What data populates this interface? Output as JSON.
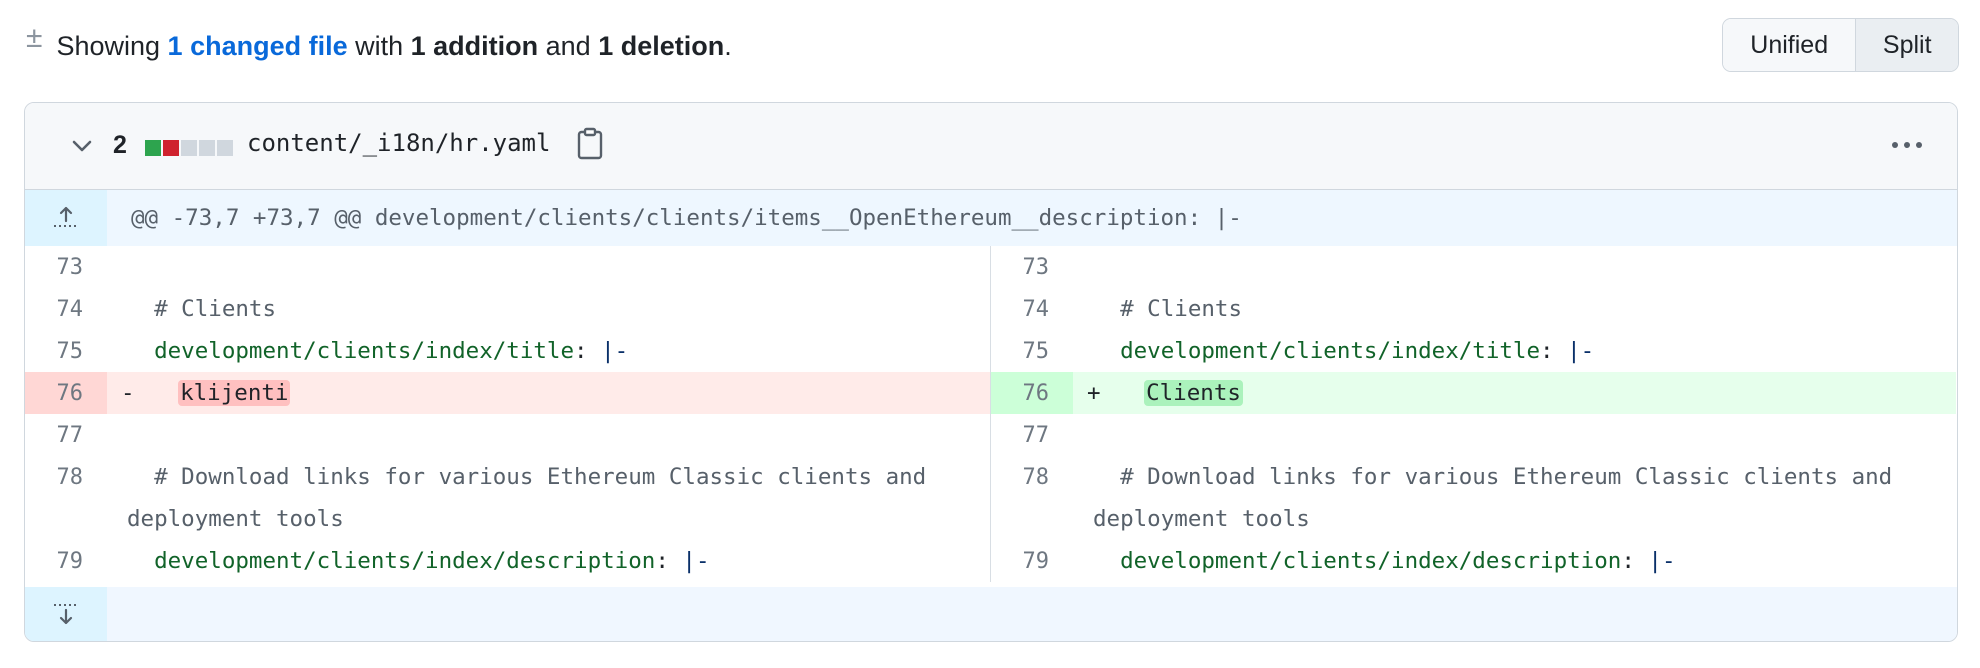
{
  "summary": {
    "prefix": "Showing ",
    "changed_link": "1 changed file",
    "mid1": " with ",
    "additions": "1 addition",
    "mid2": " and ",
    "deletions": "1 deletion",
    "suffix": "."
  },
  "view_toggle": {
    "unified": "Unified",
    "split": "Split",
    "active": "Split"
  },
  "file": {
    "change_count": "2",
    "diffstat": [
      "add",
      "del",
      "neutral",
      "neutral",
      "neutral"
    ],
    "name": "content/_i18n/hr.yaml",
    "hunk_header": "@@ -73,7 +73,7 @@ development/clients/clients/items__OpenEthereum__description: |-"
  },
  "diff": {
    "left": [
      {
        "ln": "73"
      },
      {
        "ln": "74",
        "comment": "# Clients"
      },
      {
        "ln": "75",
        "key": "development/clients/index/title",
        "op": "|-"
      },
      {
        "ln": "76",
        "marker": "-",
        "value": "klijenti"
      },
      {
        "ln": "77"
      },
      {
        "ln": "78",
        "comment": "# Download links for various Ethereum Classic clients",
        "cont": "and deployment tools"
      },
      {
        "ln": "79",
        "key": "development/clients/index/description",
        "op": "|-"
      }
    ],
    "right": [
      {
        "ln": "73"
      },
      {
        "ln": "74",
        "comment": "# Clients"
      },
      {
        "ln": "75",
        "key": "development/clients/index/title",
        "op": "|-"
      },
      {
        "ln": "76",
        "marker": "+",
        "value": "Clients"
      },
      {
        "ln": "77"
      },
      {
        "ln": "78",
        "comment": "# Download links for various Ethereum Classic clients",
        "cont": "and deployment tools"
      },
      {
        "ln": "79",
        "key": "development/clients/index/description",
        "op": "|-"
      }
    ]
  },
  "colors": {
    "link": "#0969da",
    "add": "#2da44e",
    "del": "#cf222e",
    "neutral": "#d0d7de"
  }
}
